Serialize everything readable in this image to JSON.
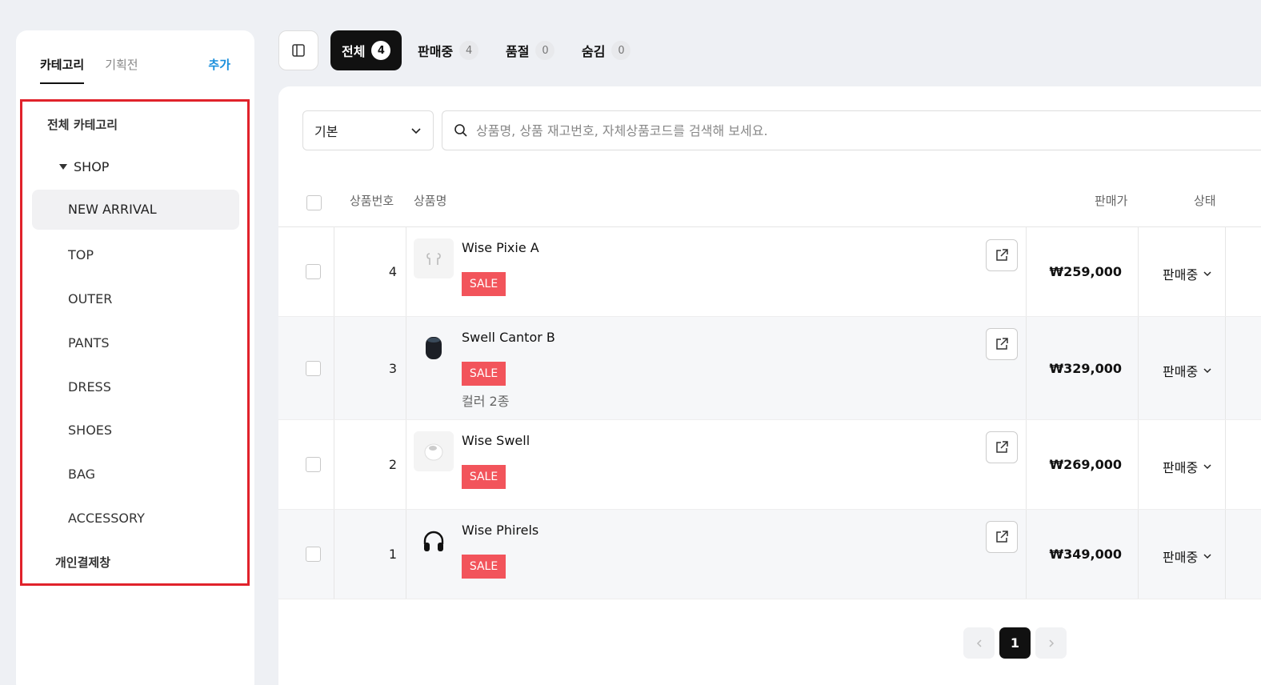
{
  "sidebar": {
    "tabs": [
      {
        "label": "카테고리",
        "active": true
      },
      {
        "label": "기획전",
        "active": false
      }
    ],
    "add_label": "추가",
    "categories": {
      "root": "전체 카테고리",
      "shop": "SHOP",
      "items": [
        "NEW ARRIVAL",
        "TOP",
        "OUTER",
        "PANTS",
        "DRESS",
        "SHOES",
        "BAG",
        "ACCESSORY"
      ],
      "active": "NEW ARRIVAL",
      "private": "개인결제창"
    }
  },
  "status_tabs": [
    {
      "label": "전체",
      "count": "4",
      "active": true
    },
    {
      "label": "판매중",
      "count": "4",
      "active": false
    },
    {
      "label": "품절",
      "count": "0",
      "active": false
    },
    {
      "label": "숨김",
      "count": "0",
      "active": false
    }
  ],
  "filters": {
    "sort_value": "기본",
    "search_placeholder": "상품명, 상품 재고번호, 자체상품코드를 검색해 보세요."
  },
  "table": {
    "headers": {
      "no": "상품번호",
      "name": "상품명",
      "price": "판매가",
      "status": "상태"
    },
    "rows": [
      {
        "no": "4",
        "name": "Wise Pixie A",
        "badge": "SALE",
        "variant": "",
        "price": "₩259,000",
        "status": "판매중",
        "thumb": "earbuds-icon"
      },
      {
        "no": "3",
        "name": "Swell Cantor B",
        "badge": "SALE",
        "variant": "컬러 2종",
        "price": "₩329,000",
        "status": "판매중",
        "thumb": "speaker-icon"
      },
      {
        "no": "2",
        "name": "Wise Swell",
        "badge": "SALE",
        "variant": "",
        "price": "₩269,000",
        "status": "판매중",
        "thumb": "round-speaker-icon"
      },
      {
        "no": "1",
        "name": "Wise Phirels",
        "badge": "SALE",
        "variant": "",
        "price": "₩349,000",
        "status": "판매중",
        "thumb": "headphones-icon"
      }
    ]
  },
  "pagination": {
    "current": "1"
  },
  "colors": {
    "accent": "#1a8fdc",
    "sale": "#f2545b",
    "highlight_border": "#e0222b",
    "active_tab": "#111111"
  }
}
